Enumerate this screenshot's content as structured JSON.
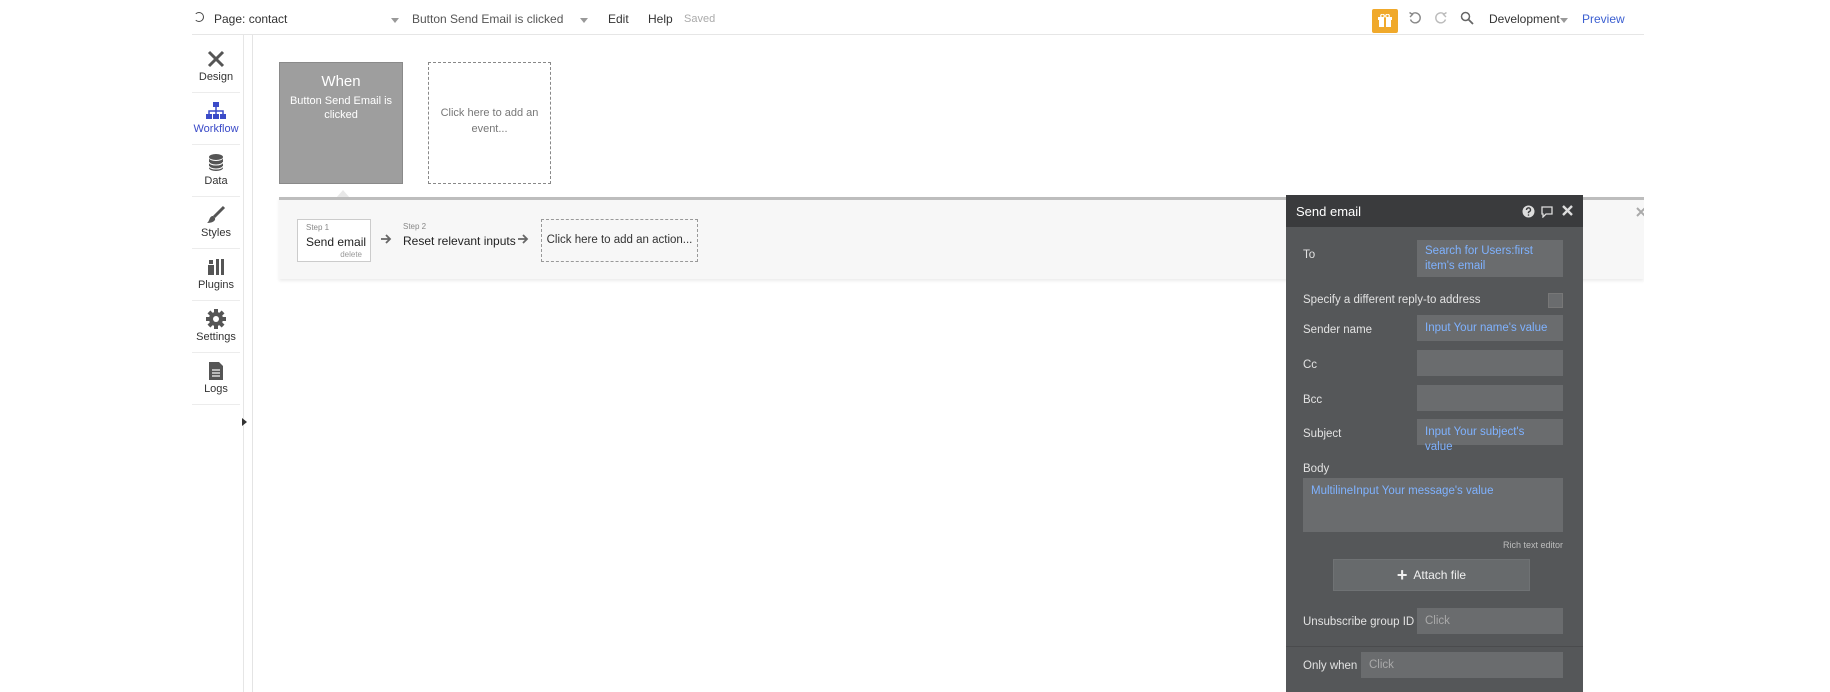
{
  "topbar": {
    "page_label": "Page: contact",
    "event_label": "Button Send Email is clicked",
    "edit": "Edit",
    "help": "Help",
    "saved": "Saved",
    "environment": "Development",
    "preview": "Preview"
  },
  "sidebar": {
    "items": [
      {
        "label": "Design"
      },
      {
        "label": "Workflow"
      },
      {
        "label": "Data"
      },
      {
        "label": "Styles"
      },
      {
        "label": "Plugins"
      },
      {
        "label": "Settings"
      },
      {
        "label": "Logs"
      }
    ]
  },
  "event": {
    "when": "When",
    "description": "Button Send Email is clicked",
    "add_event": "Click here to add an event..."
  },
  "steps": {
    "step1_num": "Step 1",
    "step1_name": "Send email",
    "step1_delete": "delete",
    "step2_num": "Step 2",
    "step2_name": "Reset relevant inputs",
    "add_action": "Click here to add an action..."
  },
  "panel": {
    "title": "Send email",
    "to_label": "To",
    "to_value": "Search for Users:first item's email",
    "reply_label": "Specify a different reply-to address",
    "sender_label": "Sender name",
    "sender_value": "Input Your name's value",
    "cc_label": "Cc",
    "bcc_label": "Bcc",
    "subject_label": "Subject",
    "subject_value": "Input Your subject's value",
    "body_label": "Body",
    "body_value": "MultilineInput Your message's value",
    "rich_text": "Rich text editor",
    "attach_label": "Attach file",
    "unsub_label": "Unsubscribe group ID",
    "unsub_placeholder": "Click",
    "onlywhen_label": "Only when",
    "onlywhen_placeholder": "Click"
  },
  "colors": {
    "accent": "#3b4bc8",
    "gift": "#f0a92b",
    "panel_bg": "#555759",
    "dynamic_text": "#7fb2ff"
  }
}
